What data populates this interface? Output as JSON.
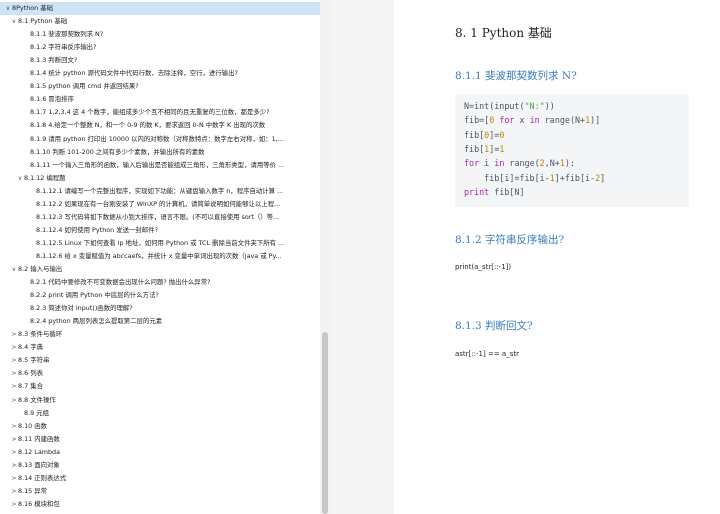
{
  "sidebar": {
    "items": [
      {
        "label": "8Python 基础",
        "arrow": "∨"
      },
      {
        "label": "8.1 Python 基础",
        "arrow": "∨"
      },
      {
        "label": "8.1.1 斐波那契数列求 N?",
        "arrow": ""
      },
      {
        "label": "8.1.2 字符串反序输出?",
        "arrow": ""
      },
      {
        "label": "8.1.3 判断回文?",
        "arrow": ""
      },
      {
        "label": "8.1.4 统计 python 源代码文件中代码行数，去除注释，空行，进行输出?",
        "arrow": ""
      },
      {
        "label": "8.1.5 python 调用 cmd 并返回结果?",
        "arrow": ""
      },
      {
        "label": "8.1.6 冒泡排序",
        "arrow": ""
      },
      {
        "label": "8.1.7 1,2,3,4 这 4 个数字，能组成多少个互不相同的且无重复的三位数，都是多少?",
        "arrow": ""
      },
      {
        "label": "8.1.8 4.给定一个整数 N，和一个 0-9 的数 K，要求返回 0-N 中数字 K 出现的次数",
        "arrow": ""
      },
      {
        "label": "8.1.9 请用 python 打印出 10000 以内的对称数（对称数特点：数字左右对称，如：1,...",
        "arrow": ""
      },
      {
        "label": "8.1.10 判断 101-200 之间有多少个素数，并输出所有的素数",
        "arrow": ""
      },
      {
        "label": "8.1.11 一个输入三角形的函数，输入后输出是否能组成三角形，三角形类型，请用等价 ...",
        "arrow": ""
      },
      {
        "label": "8.1.12 编程题",
        "arrow": "∨"
      },
      {
        "label": "8.1.12.1 请编写一个完整出程序，实现如下功能：从键盘输入数字 n，程序自动计算 ...",
        "arrow": ""
      },
      {
        "label": "8.1.12.2 如果现在有一台刚安装了 WinXP 的计算机，请简单说明如何能够让以上程...",
        "arrow": ""
      },
      {
        "label": "8.1.12.3 写代码将如下数据从小到大排序，语言不限。(不可以直接使用 sort（）等...",
        "arrow": ""
      },
      {
        "label": "8.1.12.4 如何使用 Python 发送一封邮件?",
        "arrow": ""
      },
      {
        "label": "8.1.12.5 Linux 下如何查看 ip 地址，如何用 Python 或 TCL 删除当前文件夹下所有 ...",
        "arrow": ""
      },
      {
        "label": "8.1.12.6 给 x 变量赋值为 abccaefs，并统计 x 变量中单词出现的次数（java 或 Py...",
        "arrow": ""
      },
      {
        "label": "8.2 输入与输出",
        "arrow": "∨"
      },
      {
        "label": "8.2.1 代码中要修改不可变数据会出现什么问题? 抛出什么异常?",
        "arrow": ""
      },
      {
        "label": "8.2.2 print 调用 Python 中底层的什么方法?",
        "arrow": ""
      },
      {
        "label": "8.2.3 简述你对 input()函数的理解?",
        "arrow": ""
      },
      {
        "label": "8.2.4 python 两层列表怎么提取第二层的元素",
        "arrow": ""
      },
      {
        "label": "8.3 条件与循环",
        "arrow": ">"
      },
      {
        "label": "8.4 字典",
        "arrow": ">"
      },
      {
        "label": "8.5 字符串",
        "arrow": ">"
      },
      {
        "label": "8.6 列表",
        "arrow": ">"
      },
      {
        "label": "8.7 集合",
        "arrow": ">"
      },
      {
        "label": "8.8 文件操作",
        "arrow": ">"
      },
      {
        "label": "8.9 元组",
        "arrow": ""
      },
      {
        "label": "8.10 函数",
        "arrow": ">"
      },
      {
        "label": "8.11 内建函数",
        "arrow": ">"
      },
      {
        "label": "8.12 Lambda",
        "arrow": ">"
      },
      {
        "label": "8.13 面向对象",
        "arrow": ">"
      },
      {
        "label": "8.14 正则表达式",
        "arrow": ">"
      },
      {
        "label": "8.15 异常",
        "arrow": ">"
      },
      {
        "label": "8.16 模块和包",
        "arrow": ">"
      }
    ]
  },
  "document": {
    "title": "8. 1 Python 基础",
    "sec1_heading": "8.1.1  斐波那契数列求 N?",
    "code": [
      {
        "parts": [
          {
            "t": "N=int(input(",
            "c": ""
          },
          {
            "t": "\"N:\"",
            "c": "str"
          },
          {
            "t": "))",
            "c": ""
          }
        ]
      },
      {
        "parts": [
          {
            "t": "fib=[",
            "c": ""
          },
          {
            "t": "0",
            "c": "num"
          },
          {
            "t": " ",
            "c": ""
          },
          {
            "t": "for",
            "c": "kw"
          },
          {
            "t": " x ",
            "c": ""
          },
          {
            "t": "in",
            "c": "kw"
          },
          {
            "t": " range(N+",
            "c": ""
          },
          {
            "t": "1",
            "c": "num"
          },
          {
            "t": ")]",
            "c": ""
          }
        ]
      },
      {
        "parts": [
          {
            "t": "fib[",
            "c": ""
          },
          {
            "t": "0",
            "c": "num"
          },
          {
            "t": "]=",
            "c": ""
          },
          {
            "t": "0",
            "c": "num"
          }
        ]
      },
      {
        "parts": [
          {
            "t": "fib[",
            "c": ""
          },
          {
            "t": "1",
            "c": "num"
          },
          {
            "t": "]=",
            "c": ""
          },
          {
            "t": "1",
            "c": "num"
          }
        ]
      },
      {
        "parts": [
          {
            "t": "for",
            "c": "kw"
          },
          {
            "t": " i ",
            "c": ""
          },
          {
            "t": "in",
            "c": "kw"
          },
          {
            "t": " range(",
            "c": ""
          },
          {
            "t": "2",
            "c": "num"
          },
          {
            "t": ",N+",
            "c": ""
          },
          {
            "t": "1",
            "c": "num"
          },
          {
            "t": "):",
            "c": ""
          }
        ]
      },
      {
        "parts": [
          {
            "t": "    fib[i]=fib[i-",
            "c": ""
          },
          {
            "t": "1",
            "c": "num"
          },
          {
            "t": "]+fib[i-",
            "c": ""
          },
          {
            "t": "2",
            "c": "num"
          },
          {
            "t": "]",
            "c": ""
          }
        ]
      },
      {
        "parts": [
          {
            "t": "print",
            "c": "kw"
          },
          {
            "t": " fib[N]",
            "c": ""
          }
        ]
      }
    ],
    "sec2_heading": "8.1.2  字符串反序输出?",
    "sec2_text": "print(a_str[::-1])",
    "sec3_heading": "8.1.3  判断回文?",
    "sec3_text": "astr[::-1] == a_str"
  }
}
